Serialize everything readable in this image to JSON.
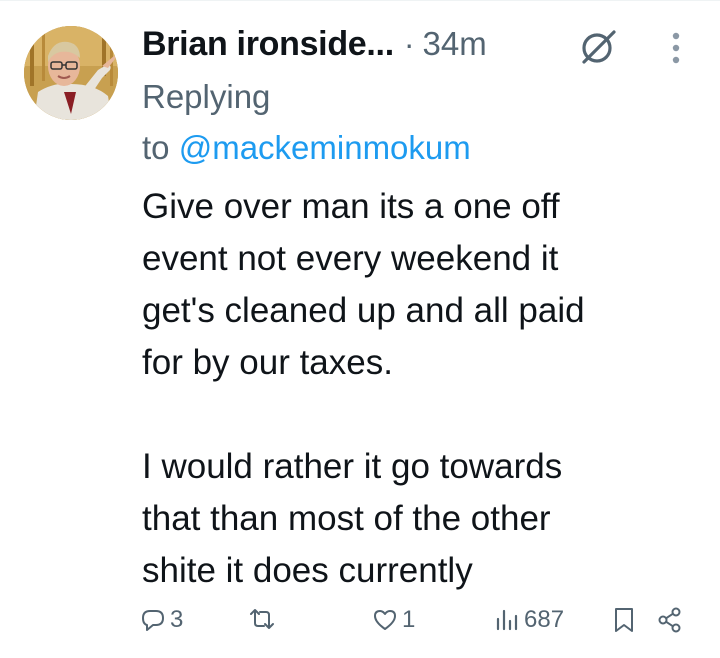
{
  "tweet": {
    "display_name": "Brian ironside...",
    "separator": "·",
    "time_ago": "34m",
    "replying_prefix": "Replying",
    "replying_to_word": "to",
    "reply_handle": "@mackeminmokum",
    "text_paragraph_1_lines": [
      "Give over man its a one off",
      "event not every weekend it",
      "get's cleaned up and all paid",
      "for by our taxes."
    ],
    "text_paragraph_2_lines": [
      "I would rather it go towards",
      "that than most of the other",
      "shite it does currently"
    ]
  },
  "actions": {
    "reply_count": "3",
    "retweet_count": "",
    "like_count": "1",
    "view_count": "687"
  },
  "icons": {
    "header": [
      "grok-icon",
      "more-vertical-icon"
    ],
    "actions": [
      "reply-icon",
      "retweet-icon",
      "like-icon",
      "views-icon",
      "bookmark-icon",
      "share-icon"
    ]
  },
  "colors": {
    "text_primary": "#0f1419",
    "text_secondary": "#536471",
    "link": "#1d9bf0",
    "divider": "#eff3f4"
  }
}
